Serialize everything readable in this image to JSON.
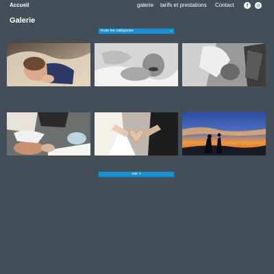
{
  "header": {
    "brand": "Accueil",
    "nav": [
      {
        "label": "galerie"
      },
      {
        "label": "tarifs et prestations"
      },
      {
        "label": "Contact"
      }
    ],
    "social": [
      {
        "icon": "facebook-icon",
        "glyph": "f"
      },
      {
        "icon": "instagram-icon",
        "glyph": "◎"
      }
    ]
  },
  "main": {
    "title": "Galerie",
    "filter": {
      "selected": "toute les catégories",
      "caret": "⌄"
    },
    "load_more": "voir +"
  },
  "gallery": {
    "photos": [
      {
        "subject": "sleeping-baby-photo"
      },
      {
        "subject": "smiling-baby-bw-photo"
      },
      {
        "subject": "couple-with-baby-bw-photo"
      },
      {
        "subject": "baptism-ceremony-photo"
      },
      {
        "subject": "wedding-heart-hands-photo"
      },
      {
        "subject": "sunset-couple-silhouette-photo"
      }
    ]
  },
  "colors": {
    "background": "#434e58",
    "accent": "#1f8fc9",
    "text": "#ffffff"
  }
}
